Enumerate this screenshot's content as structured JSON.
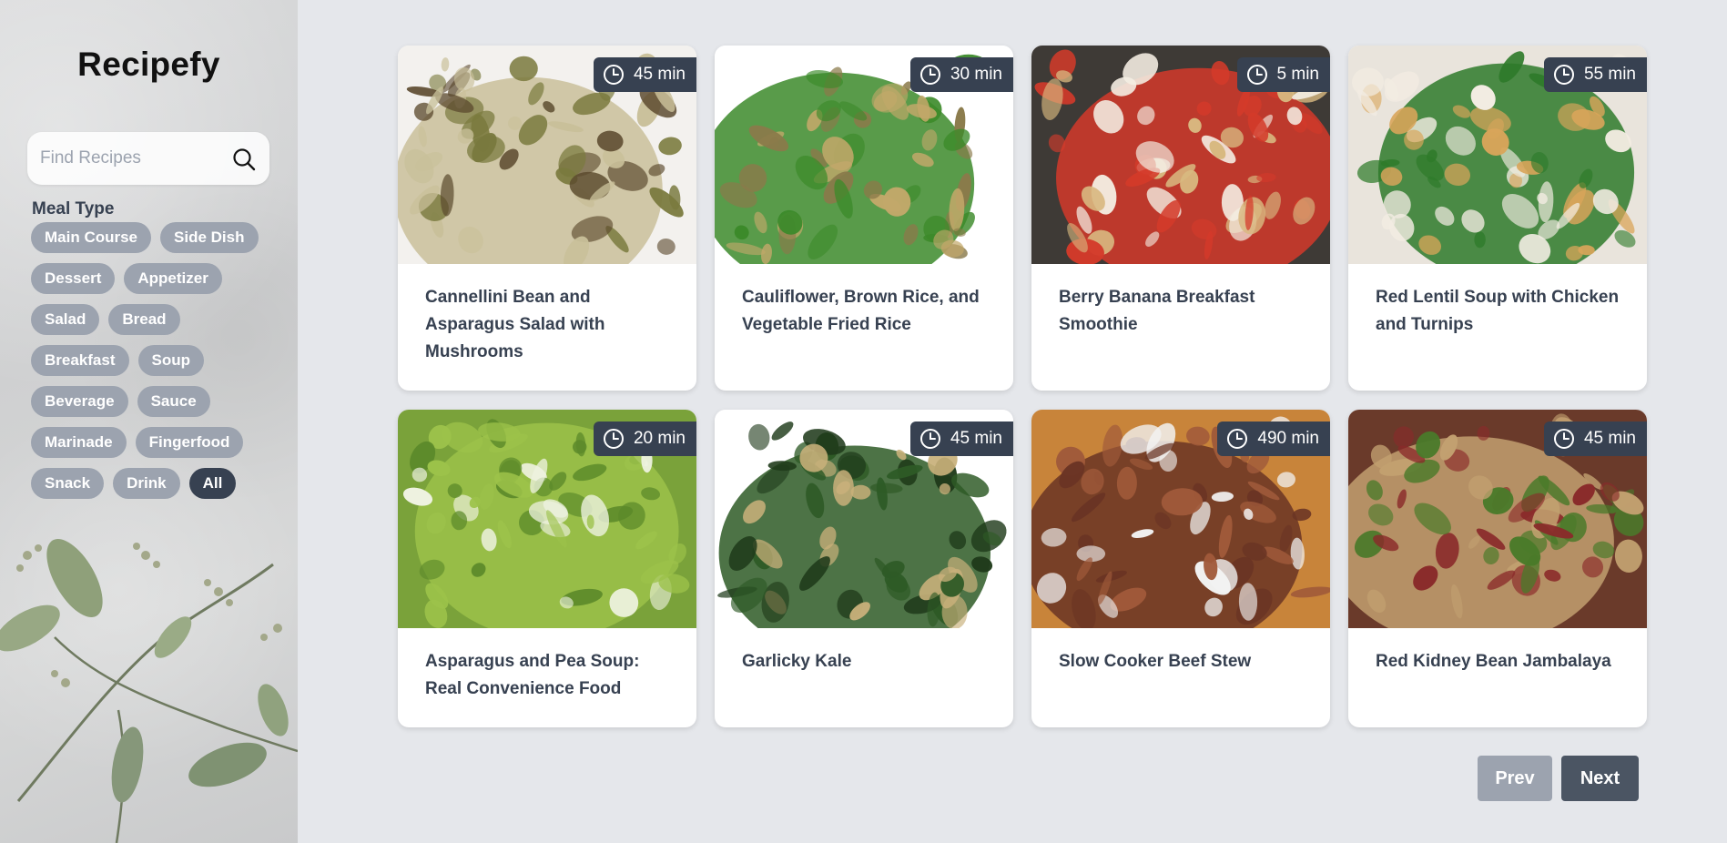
{
  "brand": "Recipefy",
  "search": {
    "placeholder": "Find Recipes",
    "value": ""
  },
  "filters": {
    "title": "Meal Type",
    "chips": [
      {
        "label": "Main Course",
        "active": false
      },
      {
        "label": "Side Dish",
        "active": false
      },
      {
        "label": "Dessert",
        "active": false
      },
      {
        "label": "Appetizer",
        "active": false
      },
      {
        "label": "Salad",
        "active": false
      },
      {
        "label": "Bread",
        "active": false
      },
      {
        "label": "Breakfast",
        "active": false
      },
      {
        "label": "Soup",
        "active": false
      },
      {
        "label": "Beverage",
        "active": false
      },
      {
        "label": "Sauce",
        "active": false
      },
      {
        "label": "Marinade",
        "active": false
      },
      {
        "label": "Fingerfood",
        "active": false
      },
      {
        "label": "Snack",
        "active": false
      },
      {
        "label": "Drink",
        "active": false
      },
      {
        "label": "All",
        "active": true
      }
    ]
  },
  "recipes": [
    {
      "title": "Cannellini Bean and Asparagus Salad with Mushrooms",
      "time": "45 min",
      "palette": [
        "#f3f1ee",
        "#7a7a3e",
        "#c9c09a",
        "#5c4a2e"
      ]
    },
    {
      "title": "Cauliflower, Brown Rice, and Vegetable Fried Rice",
      "time": "30 min",
      "palette": [
        "#ffffff",
        "#8a7a4a",
        "#3c8a2a",
        "#c2a86a"
      ]
    },
    {
      "title": "Berry Banana Breakfast Smoothie",
      "time": "5 min",
      "palette": [
        "#3e3a36",
        "#f4ede2",
        "#d43a2a",
        "#d8b880"
      ]
    },
    {
      "title": "Red Lentil Soup with Chicken and Turnips",
      "time": "55 min",
      "palette": [
        "#e9e4dc",
        "#d9a55a",
        "#2e7a2a",
        "#f2ece2"
      ]
    },
    {
      "title": "Asparagus and Pea Soup: Real Convenience Food",
      "time": "20 min",
      "palette": [
        "#7aa23a",
        "#5c8a2a",
        "#9cc24a",
        "#eef2e0"
      ]
    },
    {
      "title": "Garlicky Kale",
      "time": "45 min",
      "palette": [
        "#ffffff",
        "#1f3a1a",
        "#2e5a26",
        "#c8b07a"
      ]
    },
    {
      "title": "Slow Cooker Beef Stew",
      "time": "490 min",
      "palette": [
        "#c8843a",
        "#f2f2f2",
        "#6a3424",
        "#a05a3a"
      ]
    },
    {
      "title": "Red Kidney Bean Jambalaya",
      "time": "45 min",
      "palette": [
        "#6a3a2a",
        "#4a7a2a",
        "#c2a070",
        "#8a2a2a"
      ]
    }
  ],
  "pagination": {
    "prev_label": "Prev",
    "next_label": "Next"
  },
  "colors": {
    "accent_dark": "#374151",
    "chip_inactive": "#9ca3af",
    "page_bg": "#e5e7eb"
  }
}
